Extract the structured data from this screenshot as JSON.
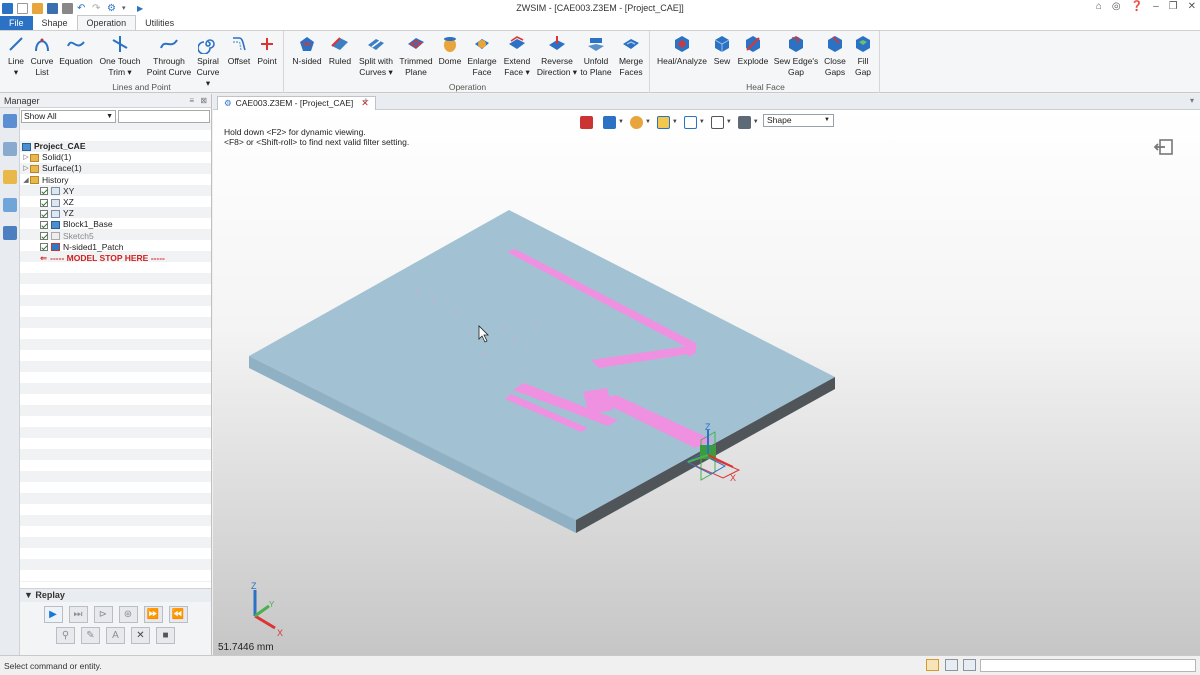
{
  "app": {
    "title": "ZWSIM - [CAE003.Z3EM - [Project_CAE]]"
  },
  "ribbon_tabs": [
    {
      "label": "File"
    },
    {
      "label": "Shape"
    },
    {
      "label": "Operation"
    },
    {
      "label": "Utilities"
    }
  ],
  "ribbon": {
    "groups": [
      {
        "label": "Lines and Point"
      },
      {
        "label": "Operation"
      },
      {
        "label": "Heal Face"
      }
    ],
    "buttons": {
      "line": "Line\n▾",
      "curve_list": "Curve\nList",
      "equation": "Equation",
      "one_touch_trim": "One Touch\nTrim ▾",
      "through_point_curve": "Through\nPoint Curve",
      "spiral_curve": "Spiral\nCurve ▾",
      "offset": "Offset",
      "point": "Point",
      "n_sided": "N-sided",
      "ruled": "Ruled",
      "split_with_curves": "Split with\nCurves ▾",
      "trimmed_plane": "Trimmed\nPlane",
      "dome": "Dome",
      "enlarge_face": "Enlarge\nFace",
      "extend_face": "Extend\nFace ▾",
      "reverse_direction": "Reverse\nDirection ▾",
      "unfold_to_plane": "Unfold\nto Plane",
      "merge_faces": "Merge\nFaces",
      "heal_analyze": "Heal/Analyze",
      "sew": "Sew",
      "explode": "Explode",
      "sew_edges_gap": "Sew Edge's\nGap",
      "close_gaps": "Close\nGaps",
      "fill_gap": "Fill\nGap"
    }
  },
  "manager": {
    "title": "Manager",
    "filter": "Show All",
    "tree": {
      "root": "Project_CAE",
      "solid": "Solid(1)",
      "surface": "Surface(1)",
      "history": "History",
      "xy": "XY",
      "xz": "XZ",
      "yz": "YZ",
      "block": "Block1_Base",
      "sketch": "Sketch5",
      "patch": "N-sided1_Patch",
      "stop": "----- MODEL STOP HERE -----"
    },
    "replay": "Replay"
  },
  "document": {
    "tab": "CAE003.Z3EM - [Project_CAE]",
    "hint_line1": "Hold down <F2> for dynamic viewing.",
    "hint_line2": "<F8> or <Shift-roll> to find next valid filter setting.",
    "filter_value": "Shape",
    "scale": "51.7446 mm",
    "axis_labels": {
      "x": "X",
      "y": "Y",
      "z": "Z"
    }
  },
  "status": {
    "message": "Select command or entity."
  },
  "colors": {
    "board": "#a2c2d4",
    "board_side": "#4f5559",
    "patch": "#f090e0",
    "accent": "#2b71c4"
  }
}
